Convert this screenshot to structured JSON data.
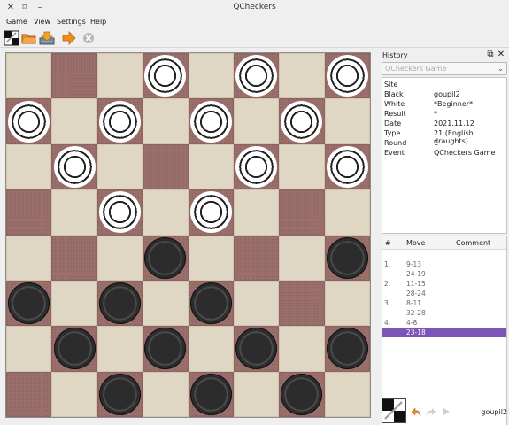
{
  "window": {
    "title": "QCheckers",
    "controls": [
      "✕",
      "⌑",
      "–"
    ]
  },
  "menu": [
    "Game",
    "View",
    "Settings",
    "Help"
  ],
  "toolbar": {
    "icons": [
      "board-icon",
      "open-folder-icon",
      "save-icon",
      "arrow-right-icon",
      "stop-icon"
    ]
  },
  "board": {
    "size": 8,
    "pieces": [
      {
        "row": 0,
        "col": 3,
        "color": "white"
      },
      {
        "row": 0,
        "col": 5,
        "color": "white"
      },
      {
        "row": 0,
        "col": 7,
        "color": "white"
      },
      {
        "row": 1,
        "col": 0,
        "color": "white"
      },
      {
        "row": 1,
        "col": 2,
        "color": "white"
      },
      {
        "row": 1,
        "col": 4,
        "color": "white"
      },
      {
        "row": 1,
        "col": 6,
        "color": "white"
      },
      {
        "row": 2,
        "col": 1,
        "color": "white"
      },
      {
        "row": 2,
        "col": 5,
        "color": "white"
      },
      {
        "row": 2,
        "col": 7,
        "color": "white"
      },
      {
        "row": 3,
        "col": 2,
        "color": "white"
      },
      {
        "row": 3,
        "col": 4,
        "color": "white"
      },
      {
        "row": 4,
        "col": 3,
        "color": "black"
      },
      {
        "row": 4,
        "col": 7,
        "color": "black"
      },
      {
        "row": 5,
        "col": 0,
        "color": "black"
      },
      {
        "row": 5,
        "col": 2,
        "color": "black"
      },
      {
        "row": 5,
        "col": 4,
        "color": "black"
      },
      {
        "row": 6,
        "col": 1,
        "color": "black"
      },
      {
        "row": 6,
        "col": 3,
        "color": "black"
      },
      {
        "row": 6,
        "col": 5,
        "color": "black"
      },
      {
        "row": 6,
        "col": 7,
        "color": "black"
      },
      {
        "row": 7,
        "col": 2,
        "color": "black"
      },
      {
        "row": 7,
        "col": 4,
        "color": "black"
      },
      {
        "row": 7,
        "col": 6,
        "color": "black"
      }
    ]
  },
  "history": {
    "title": "History",
    "game_combo": "QCheckers Game",
    "info": [
      {
        "key": "Site",
        "value": ""
      },
      {
        "key": "Black",
        "value": "goupil2"
      },
      {
        "key": "White",
        "value": "*Beginner*"
      },
      {
        "key": "Result",
        "value": "*"
      },
      {
        "key": "Date",
        "value": "2021.11.12"
      },
      {
        "key": "Type",
        "value": "21 (English draughts)"
      },
      {
        "key": "Round",
        "value": "1"
      },
      {
        "key": "Event",
        "value": "QCheckers Game"
      }
    ],
    "columns": {
      "num": "#",
      "move": "Move",
      "comment": "Comment"
    },
    "moves": [
      {
        "num": "1.",
        "move": "9-13"
      },
      {
        "num": "",
        "move": "24-19"
      },
      {
        "num": "2.",
        "move": "11-15"
      },
      {
        "num": "",
        "move": "28-24"
      },
      {
        "num": "3.",
        "move": "8-11"
      },
      {
        "num": "",
        "move": "32-28"
      },
      {
        "num": "4.",
        "move": "4-8"
      },
      {
        "num": "",
        "move": "23-18",
        "selected": true
      }
    ]
  },
  "footer": {
    "player": "goupil2"
  }
}
